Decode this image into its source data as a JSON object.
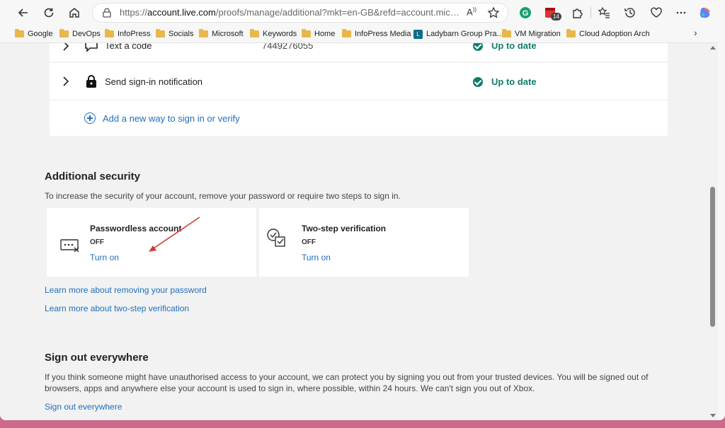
{
  "browser": {
    "url_base": "https://",
    "url_host": "account.live.com",
    "url_path": "/proofs/manage/additional?mkt=en-GB&refd=account.microsoft.co...",
    "read_aloud_label": "A",
    "notif_count": "14"
  },
  "bookmarks": [
    {
      "label": "Google"
    },
    {
      "label": "DevOps"
    },
    {
      "label": "InfoPress"
    },
    {
      "label": "Socials"
    },
    {
      "label": "Microsoft"
    },
    {
      "label": "Keywords"
    },
    {
      "label": "Home"
    },
    {
      "label": "InfoPress Media"
    },
    {
      "label": "Ladybarn Group Pra..."
    },
    {
      "label": "VM Migration"
    },
    {
      "label": "Cloud Adoption Arch"
    }
  ],
  "sign_in_methods": {
    "text_code": {
      "label": "Text a code",
      "value": "7449276055",
      "status": "Up to date"
    },
    "sign_in_notification": {
      "label": "Send sign-in notification",
      "status": "Up to date"
    },
    "add_new": "Add a new way to sign in or verify"
  },
  "additional_security": {
    "title": "Additional security",
    "description": "To increase the security of your account, remove your password or require two steps to sign in.",
    "tiles": [
      {
        "title": "Passwordless account",
        "state": "OFF",
        "action": "Turn on"
      },
      {
        "title": "Two-step verification",
        "state": "OFF",
        "action": "Turn on"
      }
    ],
    "learn_remove_password": "Learn more about removing your password",
    "learn_two_step": "Learn more about two-step verification"
  },
  "sign_out": {
    "title": "Sign out everywhere",
    "description": "If you think someone might have unauthorised access to your account, we can protect you by signing you out from your trusted devices. You will be signed out of browsers, apps and anywhere else your account is used to sign in, where possible, within 24 hours. We can't sign you out of Xbox.",
    "link": "Sign out everywhere"
  },
  "colors": {
    "accent_link": "#1f6fbf",
    "status_green": "#107c6e",
    "annotation_arrow": "#d23a3a"
  }
}
